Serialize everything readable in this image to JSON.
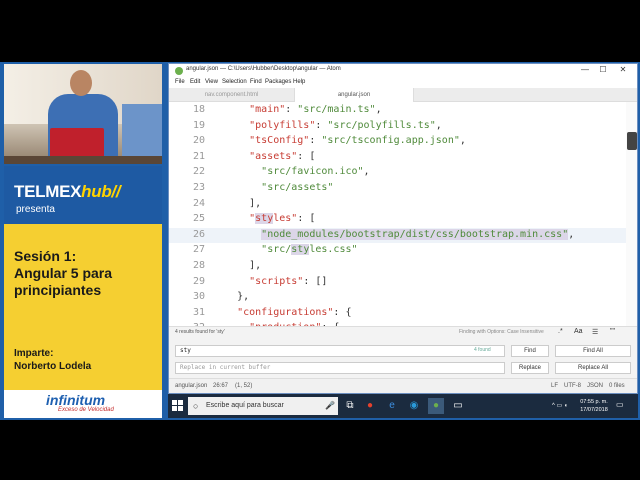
{
  "branding": {
    "brand_main": "TELMEX",
    "brand_hub": "hub",
    "brand_slashes": "//",
    "presents": "presenta",
    "session_title": "Sesión 1:\nAngular 5 para principiantes",
    "session_line1": "Sesión 1:",
    "session_line2": "Angular 5 para",
    "session_line3": "principiantes",
    "teacher_label": "Imparte:",
    "teacher_name": "Norberto Lodela",
    "logo": "infinitum",
    "logo_tagline": "Exceso de Velocidad"
  },
  "window": {
    "title": "angular.json — C:\\Users\\Hubber\\Desktop\\angular — Atom",
    "minimize": "—",
    "maximize": "☐",
    "close": "✕"
  },
  "menu": [
    "File",
    "Edit",
    "View",
    "Selection",
    "Find",
    "Packages",
    "Help"
  ],
  "tabs": [
    "nav.component.html",
    "angular.json"
  ],
  "editor": {
    "lines": [
      {
        "num": "18",
        "indent": "      ",
        "tokens": [
          {
            "t": "\"main\"",
            "c": "k"
          },
          {
            "t": ": ",
            "c": "p"
          },
          {
            "t": "\"src/main.ts\"",
            "c": "s"
          },
          {
            "t": ",",
            "c": "p"
          }
        ]
      },
      {
        "num": "19",
        "indent": "      ",
        "tokens": [
          {
            "t": "\"polyfills\"",
            "c": "k"
          },
          {
            "t": ": ",
            "c": "p"
          },
          {
            "t": "\"src/polyfills.ts\"",
            "c": "s"
          },
          {
            "t": ",",
            "c": "p"
          }
        ]
      },
      {
        "num": "20",
        "indent": "      ",
        "tokens": [
          {
            "t": "\"tsConfig\"",
            "c": "k"
          },
          {
            "t": ": ",
            "c": "p"
          },
          {
            "t": "\"src/tsconfig.app.json\"",
            "c": "s"
          },
          {
            "t": ",",
            "c": "p"
          }
        ]
      },
      {
        "num": "21",
        "indent": "      ",
        "tokens": [
          {
            "t": "\"assets\"",
            "c": "k"
          },
          {
            "t": ": [",
            "c": "p"
          }
        ]
      },
      {
        "num": "22",
        "indent": "        ",
        "tokens": [
          {
            "t": "\"src/favicon.ico\"",
            "c": "s"
          },
          {
            "t": ",",
            "c": "p"
          }
        ]
      },
      {
        "num": "23",
        "indent": "        ",
        "tokens": [
          {
            "t": "\"src/assets\"",
            "c": "s"
          }
        ]
      },
      {
        "num": "24",
        "indent": "      ",
        "tokens": [
          {
            "t": "],",
            "c": "p"
          }
        ]
      },
      {
        "num": "25",
        "indent": "      ",
        "tokens": [
          {
            "t": "\"",
            "c": "k"
          },
          {
            "t": "sty",
            "c": "k hl"
          },
          {
            "t": "les\"",
            "c": "k"
          },
          {
            "t": ": [",
            "c": "p"
          }
        ]
      },
      {
        "num": "26",
        "indent": "        ",
        "tokens": [
          {
            "t": "\"node_modules/bootstrap/dist/css/bootstrap.min.css\"",
            "c": "s hl"
          },
          {
            "t": ",",
            "c": "p"
          }
        ]
      },
      {
        "num": "27",
        "indent": "        ",
        "tokens": [
          {
            "t": "\"src/",
            "c": "s"
          },
          {
            "t": "sty",
            "c": "s hl"
          },
          {
            "t": "les.css\"",
            "c": "s"
          }
        ]
      },
      {
        "num": "28",
        "indent": "      ",
        "tokens": [
          {
            "t": "],",
            "c": "p"
          }
        ]
      },
      {
        "num": "29",
        "indent": "      ",
        "tokens": [
          {
            "t": "\"scripts\"",
            "c": "k"
          },
          {
            "t": ": []",
            "c": "p"
          }
        ]
      },
      {
        "num": "30",
        "indent": "    ",
        "tokens": [
          {
            "t": "},",
            "c": "p"
          }
        ]
      },
      {
        "num": "31",
        "indent": "    ",
        "tokens": [
          {
            "t": "\"configurations\"",
            "c": "k"
          },
          {
            "t": ": {",
            "c": "p"
          }
        ]
      },
      {
        "num": "32",
        "indent": "      ",
        "tokens": [
          {
            "t": "\"production\"",
            "c": "k"
          },
          {
            "t": ": {",
            "c": "p"
          }
        ]
      }
    ],
    "active_line": "26"
  },
  "find": {
    "results_info": "4 results found for 'sty'",
    "options_info": "Finding with Options: Case Insensitive",
    "opt_regex": ".*",
    "opt_case": "Aa",
    "opt_selection": "☰",
    "opt_word": "\"\"",
    "query": "sty",
    "count": "4 found",
    "replace_placeholder": "Replace in current buffer",
    "find_button": "Find",
    "find_all_button": "Find All",
    "replace_button": "Replace",
    "replace_all_button": "Replace All"
  },
  "status": {
    "file": "angular.json",
    "cursor": "26:67",
    "selection": "(1, 52)",
    "line_ending": "LF",
    "encoding": "UTF-8",
    "grammar": "JSON",
    "files": "0 files"
  },
  "taskbar": {
    "search_placeholder": "Escribe aquí para buscar",
    "time": "07:55 p. m.",
    "date": "17/07/2018"
  }
}
